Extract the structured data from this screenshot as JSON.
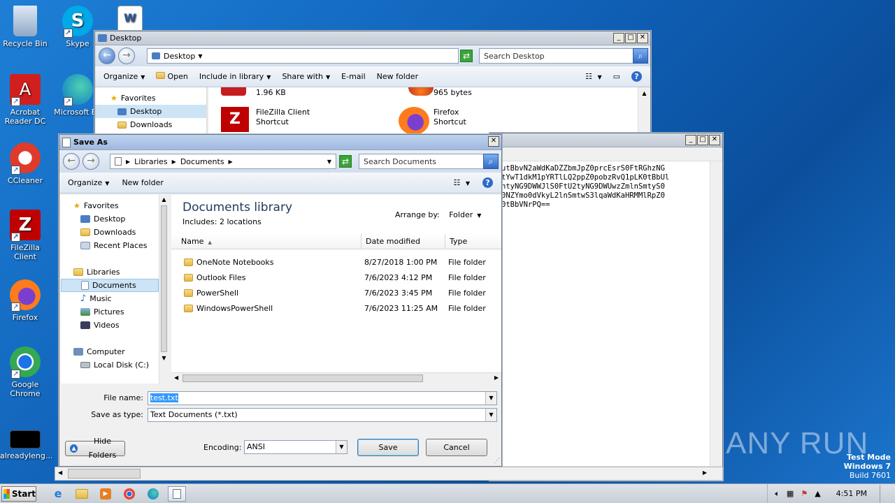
{
  "desktop": {
    "icons": [
      {
        "label": "Recycle Bin"
      },
      {
        "label": "Skype"
      },
      {
        "label": "Acrobat Reader DC"
      },
      {
        "label": "Microsoft Ed"
      },
      {
        "label": "CCleaner"
      },
      {
        "label": "FileZilla Client"
      },
      {
        "label": "Firefox"
      },
      {
        "label": "Google Chrome"
      },
      {
        "label": "alreadyleng..."
      }
    ]
  },
  "explorer": {
    "title": "Desktop",
    "address": "Desktop",
    "search_placeholder": "Search Desktop",
    "toolbar": [
      "Organize",
      "Open",
      "Include in library",
      "Share with",
      "E-mail",
      "New folder"
    ],
    "nav": {
      "favorites": "Favorites",
      "desktop": "Desktop",
      "downloads": "Downloads"
    },
    "files": [
      {
        "name": "",
        "detail": "1.96 KB"
      },
      {
        "name": "",
        "detail": "965 bytes"
      },
      {
        "name": "FileZilla Client",
        "detail": "Shortcut"
      },
      {
        "name": "Firefox",
        "detail": "Shortcut"
      }
    ]
  },
  "notepad": {
    "lines": [
      "utBbvN2aWdKaDZZbmJpZ0prcEsrS0FtRGhzNG",
      "tYwT1dkM1pYRTlLQ2ppZ0pobzRvQ1pLK0tBbUl",
      "ntyNG9DWWJlS0FtU2tyNG9DWUwzZmlnSmtyS0",
      "0NZYmo0dVkyL2lnSmtwS3lqaWdKaHRMMlRpZ0",
      "0tBbVNrPQ=="
    ]
  },
  "saveas": {
    "title": "Save As",
    "breadcrumb": [
      "Libraries",
      "Documents"
    ],
    "search_placeholder": "Search Documents",
    "toolbar": {
      "organize": "Organize",
      "new_folder": "New folder"
    },
    "nav": {
      "favorites": "Favorites",
      "fav_items": [
        "Desktop",
        "Downloads",
        "Recent Places"
      ],
      "libraries": "Libraries",
      "lib_items": [
        "Documents",
        "Music",
        "Pictures",
        "Videos"
      ],
      "computer": "Computer",
      "computer_items": [
        "Local Disk (C:)"
      ]
    },
    "library_title": "Documents library",
    "library_sub": "Includes:  2 locations",
    "arrange_label": "Arrange by:",
    "arrange_value": "Folder",
    "columns": [
      "Name",
      "Date modified",
      "Type"
    ],
    "rows": [
      {
        "name": "OneNote Notebooks",
        "date": "8/27/2018 1:00 PM",
        "type": "File folder"
      },
      {
        "name": "Outlook Files",
        "date": "7/6/2023 4:12 PM",
        "type": "File folder"
      },
      {
        "name": "PowerShell",
        "date": "7/6/2023 3:45 PM",
        "type": "File folder"
      },
      {
        "name": "WindowsPowerShell",
        "date": "7/6/2023 11:25 AM",
        "type": "File folder"
      }
    ],
    "file_name_label": "File name:",
    "file_name_value": "test.txt",
    "save_as_type_label": "Save as type:",
    "save_as_type_value": "Text Documents (*.txt)",
    "encoding_label": "Encoding:",
    "encoding_value": "ANSI",
    "hide_folders": "Hide Folders",
    "save": "Save",
    "cancel": "Cancel"
  },
  "watermark": {
    "brand": "ANY RUN",
    "mode": "Test Mode",
    "os": "Windows 7",
    "build": "Build 7601"
  },
  "taskbar": {
    "start": "Start",
    "time": "4:51 PM"
  }
}
